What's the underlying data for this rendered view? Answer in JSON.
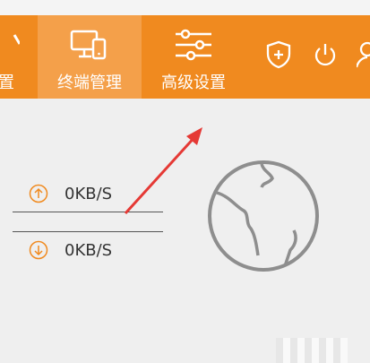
{
  "nav": {
    "tabs": [
      {
        "label": "置",
        "icon": "settings-icon"
      },
      {
        "label": "终端管理",
        "icon": "devices-icon"
      },
      {
        "label": "高级设置",
        "icon": "sliders-icon"
      }
    ],
    "right_icons": [
      "shield-icon",
      "power-icon",
      "user-icon"
    ]
  },
  "speed": {
    "upload": "0KB/S",
    "download": "0KB/S"
  },
  "colors": {
    "accent": "#f08a1f",
    "active_tab": "#f4a04a",
    "background": "#efefef"
  }
}
